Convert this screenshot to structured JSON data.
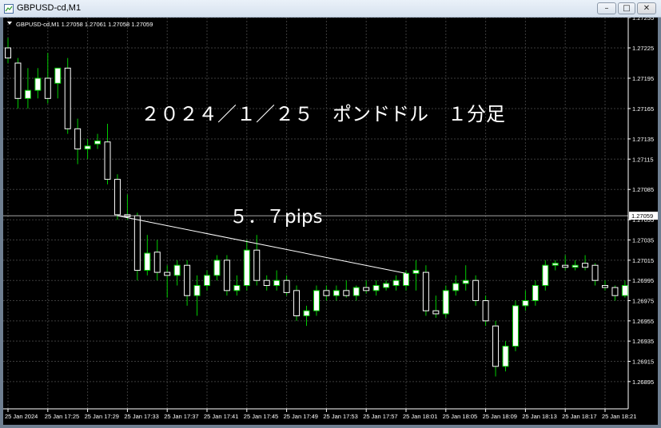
{
  "window": {
    "title": "GBPUSD-cd,M1",
    "buttons": {
      "minimize": "–",
      "maximize": "□",
      "close": "✕"
    }
  },
  "chart_header": "GBPUSD-cd,M1  1.27058 1.27061 1.27058 1.27059",
  "annotations": {
    "title": "２０２４／１／２５　ポンドドル　１分足",
    "pips": "５．７pips"
  },
  "colors": {
    "background": "#000000",
    "grid": "#3c3c3c",
    "bull": "#ffffff",
    "bear": "#ffffff",
    "wick": "#00cc00",
    "axis_text": "#ffffff",
    "current_price_label_bg": "#ffffff"
  },
  "chart_data": {
    "type": "candlestick",
    "symbol": "GBPUSD-cd",
    "timeframe": "M1",
    "ylim": [
      1.26868,
      1.27255
    ],
    "y_ticks": [
      "1.27255",
      "1.27225",
      "1.27195",
      "1.27165",
      "1.27135",
      "1.27115",
      "1.27085",
      "1.27055",
      "1.27035",
      "1.27015",
      "1.26995",
      "1.26975",
      "1.26955",
      "1.26935",
      "1.26915",
      "1.26895"
    ],
    "x_ticks": [
      "25 Jan 2024",
      "25 Jan 17:25",
      "25 Jan 17:29",
      "25 Jan 17:33",
      "25 Jan 17:37",
      "25 Jan 17:41",
      "25 Jan 17:45",
      "25 Jan 17:49",
      "25 Jan 17:53",
      "25 Jan 17:57",
      "25 Jan 18:01",
      "25 Jan 18:05",
      "25 Jan 18:09",
      "25 Jan 18:13",
      "25 Jan 18:17",
      "25 Jan 18:21"
    ],
    "current_price": "1.27059",
    "trendline": {
      "start_index": 11,
      "start_price": 1.27059,
      "end_index": 40,
      "end_price": 1.27002
    },
    "candles": [
      {
        "o": 1.27225,
        "h": 1.27235,
        "l": 1.2721,
        "c": 1.27215
      },
      {
        "o": 1.2721,
        "h": 1.27215,
        "l": 1.27165,
        "c": 1.27175
      },
      {
        "o": 1.27175,
        "h": 1.27205,
        "l": 1.27165,
        "c": 1.27183
      },
      {
        "o": 1.27183,
        "h": 1.27205,
        "l": 1.27175,
        "c": 1.27195
      },
      {
        "o": 1.27195,
        "h": 1.2722,
        "l": 1.2717,
        "c": 1.27175
      },
      {
        "o": 1.2719,
        "h": 1.27205,
        "l": 1.27175,
        "c": 1.27205
      },
      {
        "o": 1.27205,
        "h": 1.27215,
        "l": 1.2714,
        "c": 1.27145
      },
      {
        "o": 1.27145,
        "h": 1.27155,
        "l": 1.2711,
        "c": 1.27125
      },
      {
        "o": 1.27125,
        "h": 1.27135,
        "l": 1.27115,
        "c": 1.27128
      },
      {
        "o": 1.2713,
        "h": 1.2714,
        "l": 1.27125,
        "c": 1.27133
      },
      {
        "o": 1.27132,
        "h": 1.2715,
        "l": 1.2709,
        "c": 1.27095
      },
      {
        "o": 1.27095,
        "h": 1.271,
        "l": 1.27055,
        "c": 1.2706
      },
      {
        "o": 1.2706,
        "h": 1.2708,
        "l": 1.27055,
        "c": 1.27058
      },
      {
        "o": 1.27059,
        "h": 1.27062,
        "l": 1.26995,
        "c": 1.27005
      },
      {
        "o": 1.27005,
        "h": 1.2704,
        "l": 1.27,
        "c": 1.27022
      },
      {
        "o": 1.27023,
        "h": 1.27035,
        "l": 1.26995,
        "c": 1.27003
      },
      {
        "o": 1.27003,
        "h": 1.2701,
        "l": 1.26978,
        "c": 1.27
      },
      {
        "o": 1.27,
        "h": 1.27015,
        "l": 1.2699,
        "c": 1.2701
      },
      {
        "o": 1.2701,
        "h": 1.27015,
        "l": 1.2697,
        "c": 1.2698
      },
      {
        "o": 1.2698,
        "h": 1.27,
        "l": 1.2696,
        "c": 1.2699
      },
      {
        "o": 1.2699,
        "h": 1.27005,
        "l": 1.26985,
        "c": 1.27
      },
      {
        "o": 1.27,
        "h": 1.2702,
        "l": 1.26995,
        "c": 1.27015
      },
      {
        "o": 1.27015,
        "h": 1.2702,
        "l": 1.2698,
        "c": 1.26985
      },
      {
        "o": 1.26985,
        "h": 1.27,
        "l": 1.2698,
        "c": 1.2699
      },
      {
        "o": 1.2699,
        "h": 1.27035,
        "l": 1.26985,
        "c": 1.27025
      },
      {
        "o": 1.27025,
        "h": 1.2704,
        "l": 1.2699,
        "c": 1.26995
      },
      {
        "o": 1.26995,
        "h": 1.27,
        "l": 1.26985,
        "c": 1.2699
      },
      {
        "o": 1.2699,
        "h": 1.27005,
        "l": 1.26985,
        "c": 1.26995
      },
      {
        "o": 1.26995,
        "h": 1.27,
        "l": 1.2698,
        "c": 1.26983
      },
      {
        "o": 1.26985,
        "h": 1.2699,
        "l": 1.26955,
        "c": 1.2696
      },
      {
        "o": 1.2696,
        "h": 1.2697,
        "l": 1.2695,
        "c": 1.26965
      },
      {
        "o": 1.26965,
        "h": 1.2699,
        "l": 1.2696,
        "c": 1.26985
      },
      {
        "o": 1.26985,
        "h": 1.2699,
        "l": 1.26975,
        "c": 1.2698
      },
      {
        "o": 1.2698,
        "h": 1.2699,
        "l": 1.26975,
        "c": 1.26985
      },
      {
        "o": 1.26985,
        "h": 1.26995,
        "l": 1.26978,
        "c": 1.2698
      },
      {
        "o": 1.2698,
        "h": 1.2699,
        "l": 1.26975,
        "c": 1.26988
      },
      {
        "o": 1.26988,
        "h": 1.26995,
        "l": 1.26982,
        "c": 1.26985
      },
      {
        "o": 1.26985,
        "h": 1.26995,
        "l": 1.2698,
        "c": 1.2699
      },
      {
        "o": 1.26988,
        "h": 1.26995,
        "l": 1.26985,
        "c": 1.26992
      },
      {
        "o": 1.2699,
        "h": 1.27,
        "l": 1.26985,
        "c": 1.26995
      },
      {
        "o": 1.2699,
        "h": 1.27005,
        "l": 1.26985,
        "c": 1.27002
      },
      {
        "o": 1.27002,
        "h": 1.27015,
        "l": 1.26985,
        "c": 1.27005
      },
      {
        "o": 1.27003,
        "h": 1.2701,
        "l": 1.2696,
        "c": 1.26965
      },
      {
        "o": 1.26965,
        "h": 1.2698,
        "l": 1.26958,
        "c": 1.26962
      },
      {
        "o": 1.26962,
        "h": 1.2699,
        "l": 1.26958,
        "c": 1.26985
      },
      {
        "o": 1.26985,
        "h": 1.27,
        "l": 1.2698,
        "c": 1.26992
      },
      {
        "o": 1.26992,
        "h": 1.2701,
        "l": 1.26985,
        "c": 1.26995
      },
      {
        "o": 1.26995,
        "h": 1.27,
        "l": 1.2697,
        "c": 1.26975
      },
      {
        "o": 1.26975,
        "h": 1.2698,
        "l": 1.2695,
        "c": 1.26955
      },
      {
        "o": 1.2695,
        "h": 1.26955,
        "l": 1.269,
        "c": 1.2691
      },
      {
        "o": 1.2691,
        "h": 1.26935,
        "l": 1.26905,
        "c": 1.2693
      },
      {
        "o": 1.2693,
        "h": 1.26975,
        "l": 1.26925,
        "c": 1.2697
      },
      {
        "o": 1.2697,
        "h": 1.26985,
        "l": 1.26965,
        "c": 1.26975
      },
      {
        "o": 1.26975,
        "h": 1.26995,
        "l": 1.2697,
        "c": 1.2699
      },
      {
        "o": 1.2699,
        "h": 1.27015,
        "l": 1.26985,
        "c": 1.2701
      },
      {
        "o": 1.2701,
        "h": 1.27015,
        "l": 1.27005,
        "c": 1.27012
      },
      {
        "o": 1.2701,
        "h": 1.2702,
        "l": 1.27005,
        "c": 1.27008
      },
      {
        "o": 1.27008,
        "h": 1.27015,
        "l": 1.27005,
        "c": 1.2701
      },
      {
        "o": 1.27012,
        "h": 1.2702,
        "l": 1.27005,
        "c": 1.27008
      },
      {
        "o": 1.2701,
        "h": 1.27012,
        "l": 1.2699,
        "c": 1.26995
      },
      {
        "o": 1.2699,
        "h": 1.26995,
        "l": 1.26985,
        "c": 1.26988
      },
      {
        "o": 1.26988,
        "h": 1.2699,
        "l": 1.26975,
        "c": 1.2698
      },
      {
        "o": 1.2698,
        "h": 1.26995,
        "l": 1.26978,
        "c": 1.2699
      }
    ]
  }
}
